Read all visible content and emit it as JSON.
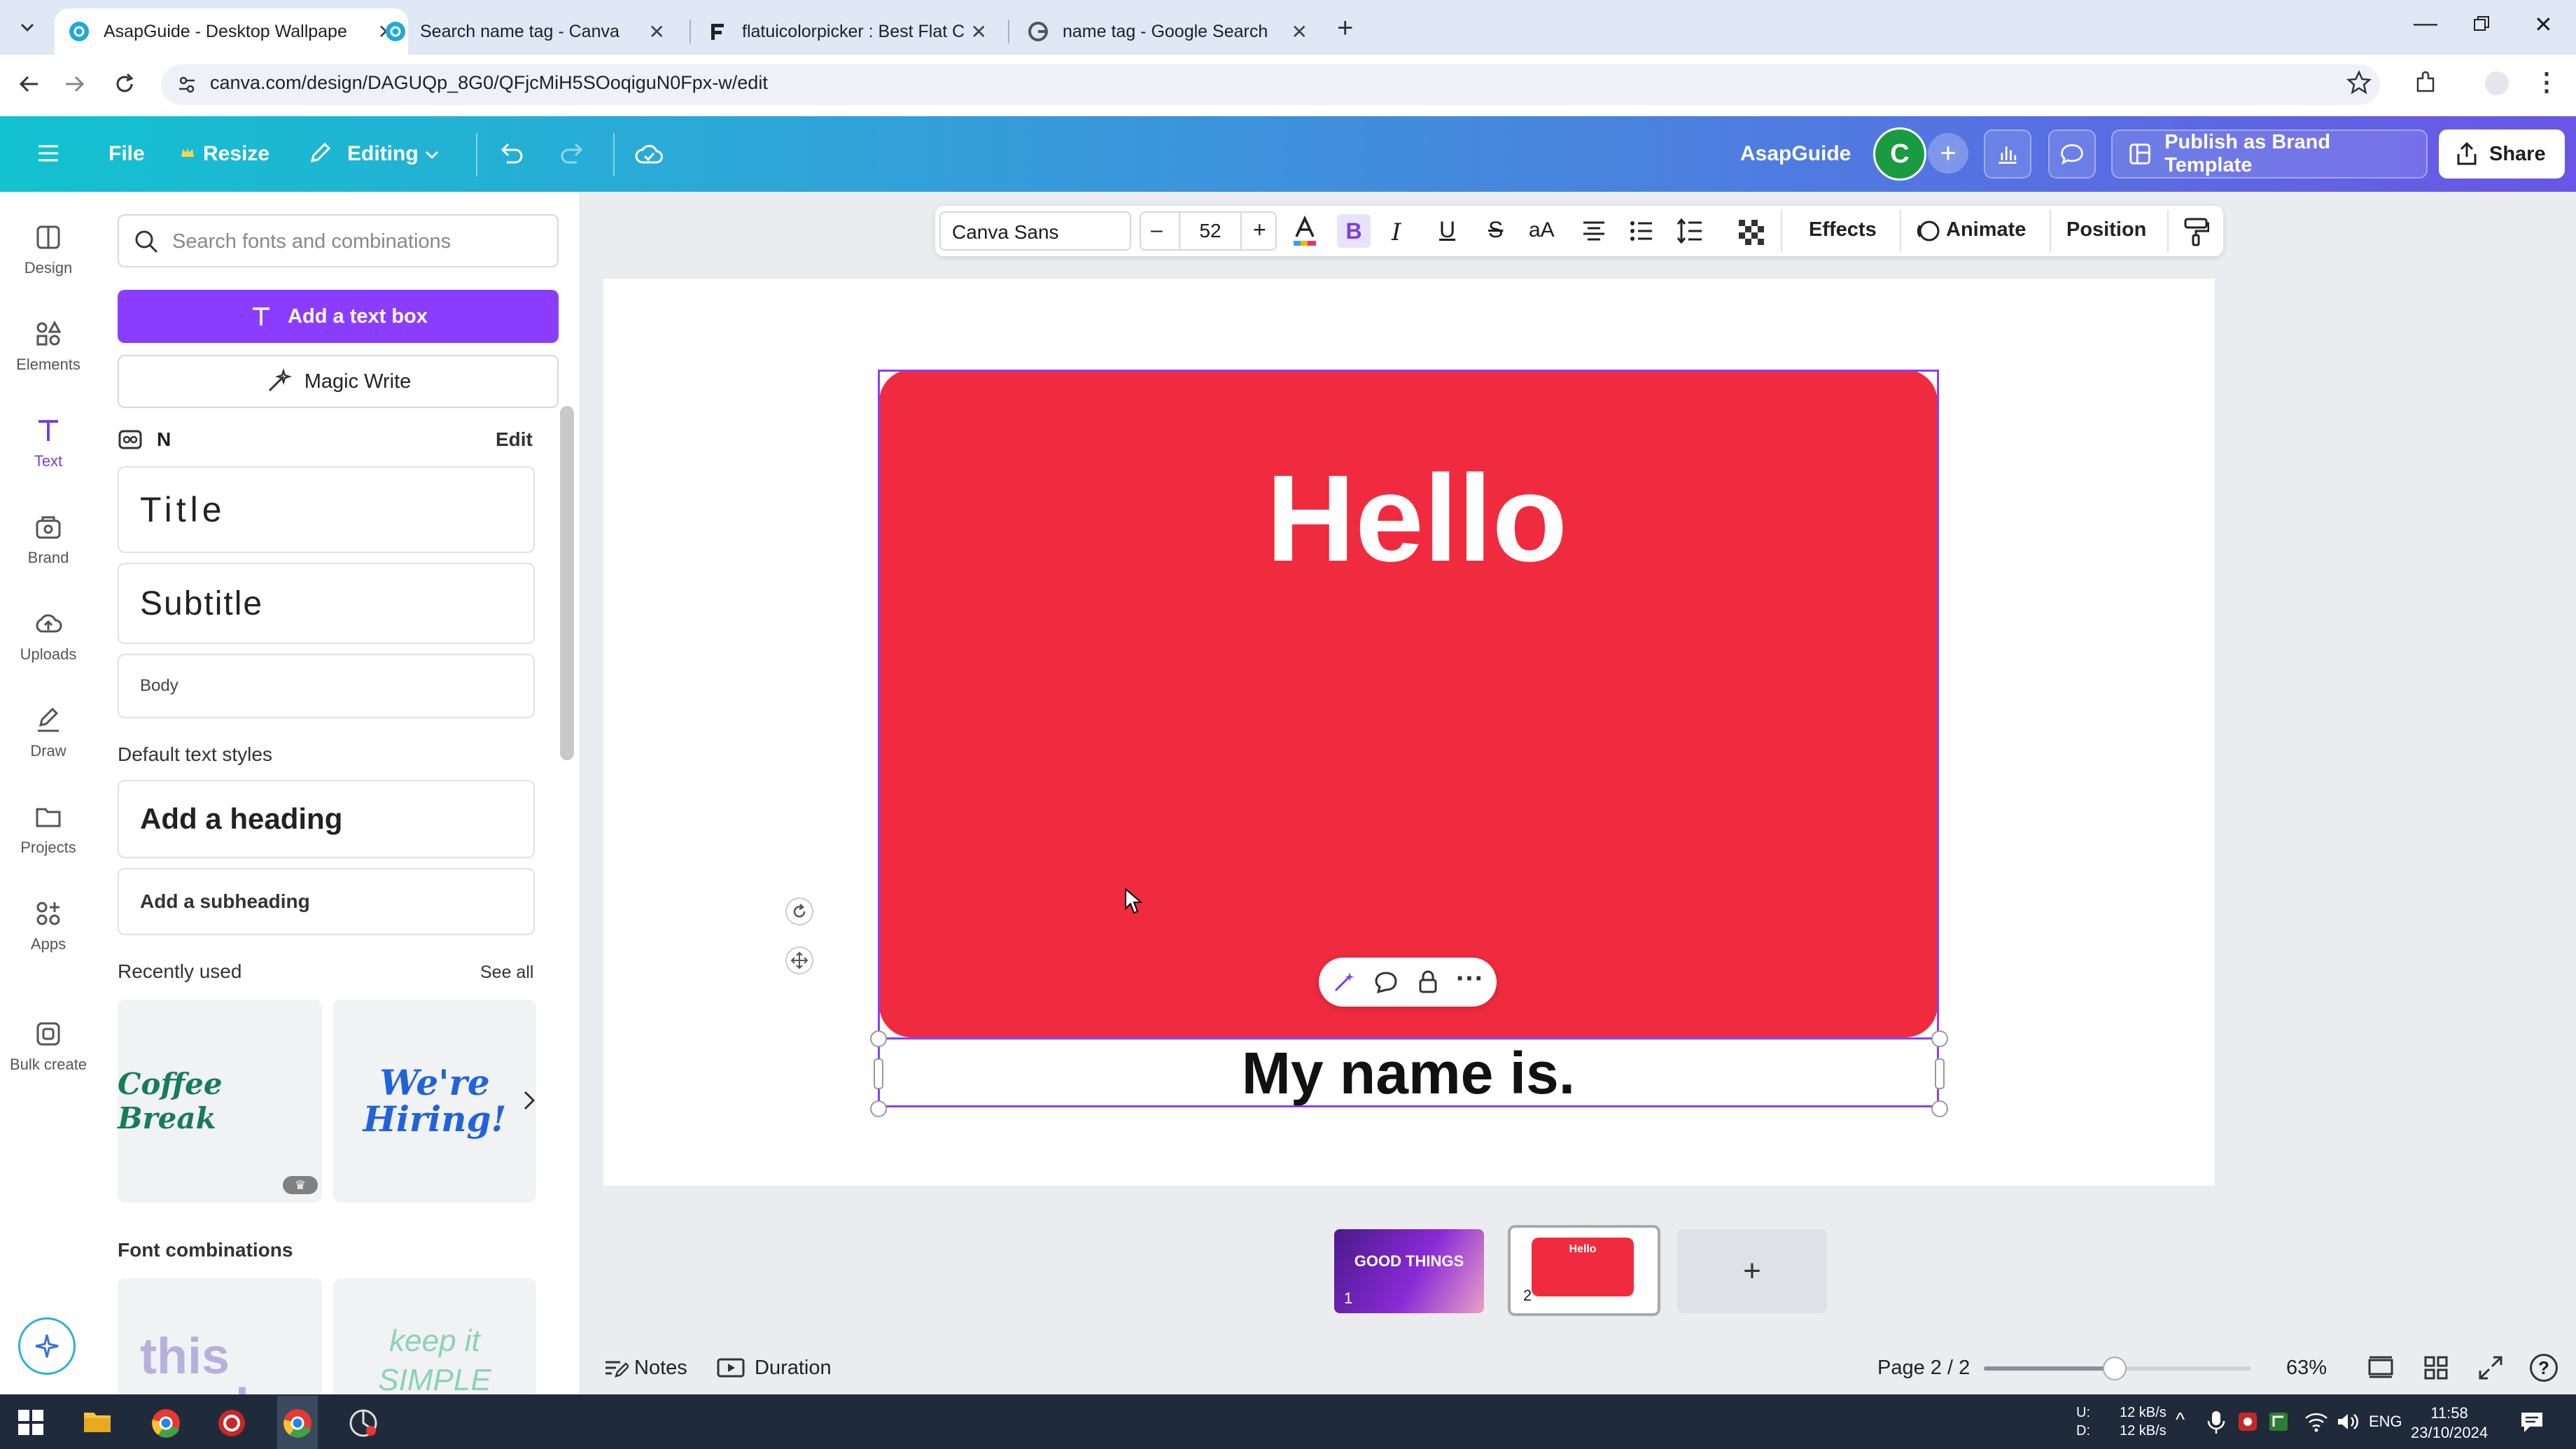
{
  "browser": {
    "tabs": [
      {
        "title": "AsapGuide - Desktop Wallpape",
        "icon": "canva-icon"
      },
      {
        "title": "Search name tag - Canva",
        "icon": "canva-icon"
      },
      {
        "title": "flatuicolorpicker : Best Flat Colo",
        "icon": "flat-icon"
      },
      {
        "title": "name tag - Google Search",
        "icon": "google-icon"
      }
    ],
    "url": "canva.com/design/DAGUQp_8G0/QFjcMiH5SOoqiguN0Fpx-w/edit"
  },
  "canva_bar": {
    "file": "File",
    "resize": "Resize",
    "editing": "Editing",
    "team_name": "AsapGuide",
    "avatar_letter": "C",
    "publish": "Publish as Brand Template",
    "share": "Share"
  },
  "rail": [
    {
      "label": "Design",
      "icon": "design-icon"
    },
    {
      "label": "Elements",
      "icon": "elements-icon"
    },
    {
      "label": "Text",
      "icon": "text-icon",
      "selected": true
    },
    {
      "label": "Brand",
      "icon": "brand-icon"
    },
    {
      "label": "Uploads",
      "icon": "uploads-icon"
    },
    {
      "label": "Draw",
      "icon": "draw-icon"
    },
    {
      "label": "Projects",
      "icon": "projects-icon"
    },
    {
      "label": "Apps",
      "icon": "apps-icon"
    },
    {
      "label": "Bulk create",
      "icon": "bulk-create-icon"
    }
  ],
  "panel": {
    "search_placeholder": "Search fonts and combinations",
    "add_text_box": "Add a text box",
    "magic_write": "Magic Write",
    "brand_kit_letter": "N",
    "edit": "Edit",
    "brand_styles": {
      "title": "Title",
      "subtitle": "Subtitle",
      "body": "Body"
    },
    "default_styles_label": "Default text styles",
    "add_heading": "Add a heading",
    "add_subheading": "Add a subheading",
    "recently_used_label": "Recently used",
    "see_all": "See all",
    "recent": [
      "Coffee Break",
      "We're Hiring!"
    ],
    "font_combinations_label": "Font combinations",
    "combos": [
      "this week",
      "keep it SIMPLE"
    ]
  },
  "toolbar": {
    "font": "Canva Sans",
    "minus": "–",
    "size": "52",
    "plus": "+",
    "bold": "B",
    "italic": "I",
    "underline": "U",
    "strike": "S",
    "case": "aA",
    "effects": "Effects",
    "animate": "Animate",
    "position": "Position"
  },
  "design": {
    "hello": "Hello",
    "name_line": "My name is.",
    "card_color": "#f12b3f"
  },
  "pages": {
    "thumb1_text": "GOOD THINGS",
    "thumb1_num": "1",
    "thumb2_text": "Hello",
    "thumb2_num": "2",
    "add": "+"
  },
  "footer": {
    "notes": "Notes",
    "duration": "Duration",
    "page_indicator": "Page 2 / 2",
    "zoom": "63%",
    "zoom_fraction": 0.49
  },
  "taskbar": {
    "net_up_label": "U:",
    "net_down_label": "D:",
    "net_up": "12 kB/s",
    "net_down": "12 kB/s",
    "lang": "ENG",
    "time": "11:58",
    "date": "23/10/2024"
  },
  "colors": {
    "purple_accent": "#7d3cf0",
    "card_red": "#f12b3f",
    "selection": "#8b3dff"
  }
}
